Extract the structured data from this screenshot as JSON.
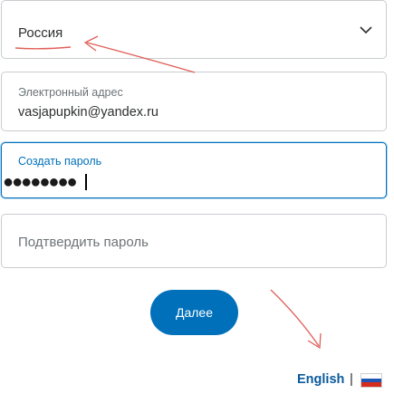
{
  "country": {
    "value": "Россия",
    "icon": "chevron-down-icon"
  },
  "email": {
    "label": "Электронный адрес",
    "value": "vasjapupkin@yandex.ru"
  },
  "password": {
    "label": "Создать пароль",
    "masked_value": "●●●●●●●●"
  },
  "confirm_password": {
    "placeholder": "Подтвердить пароль"
  },
  "next_button": {
    "label": "Далее"
  },
  "footer": {
    "language_link": "English",
    "separator": "|",
    "flag_icon": "russia-flag-icon"
  },
  "colors": {
    "accent": "#0070ba",
    "annotation": "#e0605a",
    "flag_white": "#ffffff",
    "flag_blue": "#1f56b3",
    "flag_red": "#d52b1e"
  }
}
